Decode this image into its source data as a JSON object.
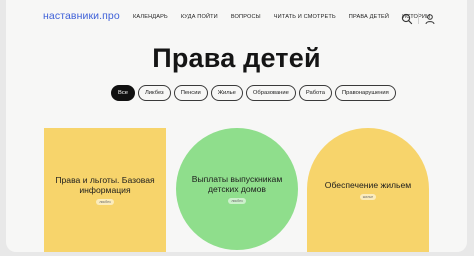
{
  "header": {
    "logo": "наставники.про",
    "nav": [
      "Календарь",
      "Куда пойти",
      "Вопросы",
      "Читать и смотреть",
      "Права детей",
      "Истории"
    ],
    "icons": [
      "search-icon",
      "user-icon"
    ]
  },
  "page": {
    "title": "Права детей"
  },
  "filters": [
    {
      "label": "Все",
      "active": true
    },
    {
      "label": "Ликбез",
      "active": false
    },
    {
      "label": "Пенсии",
      "active": false
    },
    {
      "label": "Жилье",
      "active": false
    },
    {
      "label": "Образование",
      "active": false
    },
    {
      "label": "Работа",
      "active": false
    },
    {
      "label": "Правонарушения",
      "active": false
    }
  ],
  "cards": [
    {
      "title": "Права и льготы. Базовая информация",
      "tag": "ликбез",
      "color": "#f7d46b"
    },
    {
      "title": "Выплаты выпускникам детских домов",
      "tag": "ликбез",
      "color": "#8fde8c"
    },
    {
      "title": "Обеспечение жильем",
      "tag": "жилье",
      "color": "#f7d46b"
    }
  ]
}
